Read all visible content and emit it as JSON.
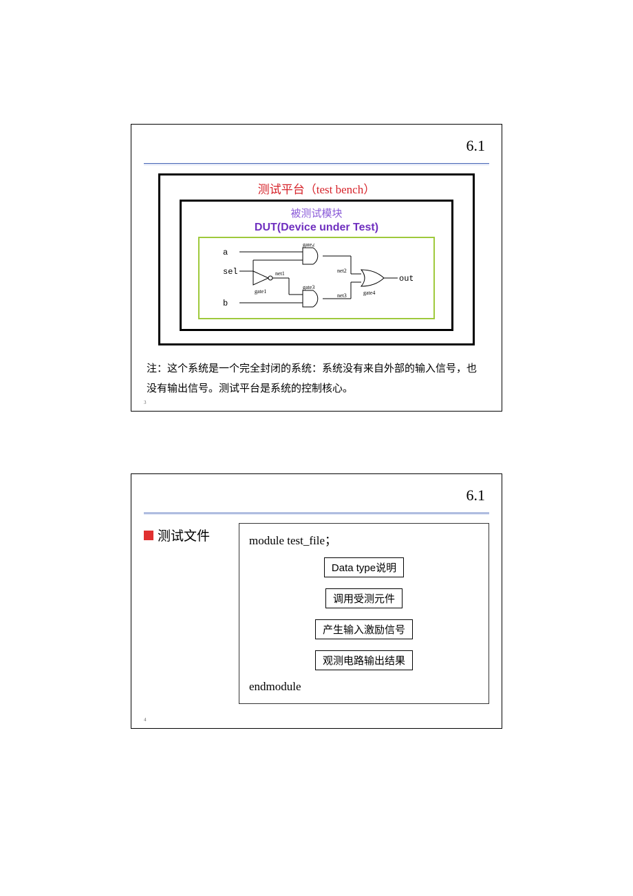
{
  "section": "6.1",
  "slide1": {
    "tb_title": "测试平台（test bench）",
    "dut_label1": "被测试模块",
    "dut_label2": "DUT(Device under Test)",
    "circuit": {
      "inputs": {
        "a": "a",
        "sel": "sel",
        "b": "b"
      },
      "nets": {
        "net1": "net1",
        "net2": "net2",
        "net3": "net3"
      },
      "gates": {
        "g1": "gate1",
        "g2": "gate2",
        "g3": "gate3",
        "g4": "gate4"
      },
      "out": "out"
    },
    "note": "注：这个系统是一个完全封闭的系统：系统没有来自外部的输入信号，也没有输出信号。测试平台是系统的控制核心。",
    "page": "3"
  },
  "slide2": {
    "bullet": "测试文件",
    "module_open": "module test_file；",
    "steps": [
      "Data type说明",
      "调用受测元件",
      "产生输入激励信号",
      "观测电路输出结果"
    ],
    "module_close": "endmodule",
    "page": "4"
  }
}
